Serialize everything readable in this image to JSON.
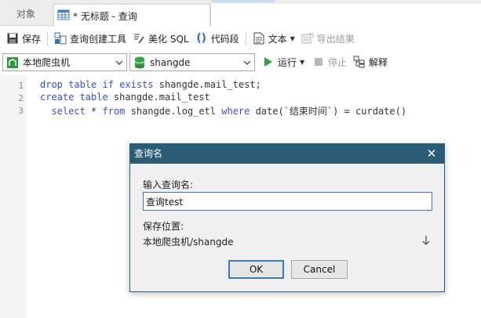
{
  "tabs": {
    "objects_label": "对象",
    "query_tab_label": "* 无标题 - 查询"
  },
  "toolbar": {
    "save": "保存",
    "query_builder": "查询创建工具",
    "beautify": "美化 SQL",
    "snippet": "代码段",
    "text": "文本",
    "export": "导出结果"
  },
  "connection_select": {
    "value": "本地爬虫机"
  },
  "database_select": {
    "value": "shangde"
  },
  "run_controls": {
    "run": "运行",
    "stop": "停止",
    "explain": "解释"
  },
  "editor": {
    "line_numbers": [
      "1",
      "2",
      "3"
    ],
    "lines": [
      [
        {
          "t": "drop table if exists",
          "c": "kw"
        },
        {
          "t": " shangde.mail_test;",
          "c": ""
        }
      ],
      [
        {
          "t": "create table",
          "c": "kw"
        },
        {
          "t": " shangde.mail_test",
          "c": ""
        }
      ],
      [
        {
          "t": "  ",
          "c": ""
        },
        {
          "t": "select",
          "c": "kw"
        },
        {
          "t": " * ",
          "c": ""
        },
        {
          "t": "from",
          "c": "kw"
        },
        {
          "t": " shangde.log_etl ",
          "c": ""
        },
        {
          "t": "where",
          "c": "kw"
        },
        {
          "t": " date(`结束时间`) = curdate()",
          "c": ""
        }
      ]
    ]
  },
  "dialog": {
    "title": "查询名",
    "close": "✕",
    "name_label": "输入查询名:",
    "name_value": "查询test",
    "location_label": "保存位置:",
    "location_value": "本地爬虫机/shangde",
    "ok": "OK",
    "cancel": "Cancel"
  },
  "colors": {
    "dialog_title_bg": "#2a5c76",
    "keyword": "#3a4fc5",
    "focus_border": "#3d79b5"
  }
}
